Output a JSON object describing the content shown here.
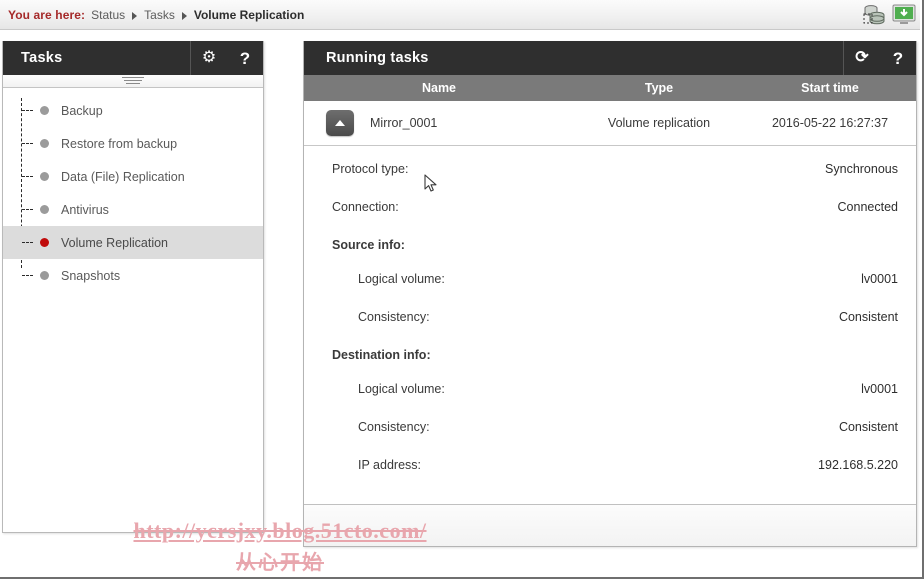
{
  "breadcrumb": {
    "lead": "You are here:",
    "items": [
      "Status",
      "Tasks",
      "Volume Replication"
    ]
  },
  "top_icons": [
    {
      "name": "storage-database-icon"
    },
    {
      "name": "monitor-screen-icon"
    }
  ],
  "sidebar": {
    "title": "Tasks",
    "header_buttons": [
      {
        "name": "gear-icon",
        "glyph": "⚙"
      },
      {
        "name": "help-icon",
        "glyph": "?"
      }
    ],
    "items": [
      {
        "label": "Backup",
        "selected": false
      },
      {
        "label": "Restore from backup",
        "selected": false
      },
      {
        "label": "Data (File) Replication",
        "selected": false
      },
      {
        "label": "Antivirus",
        "selected": false
      },
      {
        "label": "Volume Replication",
        "selected": true
      },
      {
        "label": "Snapshots",
        "selected": false
      }
    ]
  },
  "main": {
    "title": "Running tasks",
    "header_buttons": [
      {
        "name": "refresh-icon",
        "glyph": "⟳"
      },
      {
        "name": "help-icon",
        "glyph": "?"
      }
    ],
    "columns": {
      "name": "Name",
      "type": "Type",
      "start_time": "Start time"
    },
    "task": {
      "name": "Mirror_0001",
      "type": "Volume replication",
      "start_time": "2016-05-22 16:27:37",
      "expanded": true
    },
    "details": [
      {
        "label": "Protocol type:",
        "value": "Synchronous",
        "kind": "row"
      },
      {
        "label": "Connection:",
        "value": "Connected",
        "kind": "row"
      },
      {
        "label": "Source info:",
        "value": "",
        "kind": "section"
      },
      {
        "label": "Logical volume:",
        "value": "lv0001",
        "kind": "indent"
      },
      {
        "label": "Consistency:",
        "value": "Consistent",
        "kind": "indent"
      },
      {
        "label": "Destination info:",
        "value": "",
        "kind": "section"
      },
      {
        "label": "Logical volume:",
        "value": "lv0001",
        "kind": "indent"
      },
      {
        "label": "Consistency:",
        "value": "Consistent",
        "kind": "indent"
      },
      {
        "label": "IP address:",
        "value": "192.168.5.220",
        "kind": "indent"
      }
    ]
  },
  "watermark": {
    "url": "http://ycrsjxy.blog.51cto.com/",
    "tagline": "从心开始"
  },
  "colors": {
    "header_dark": "#2f2f2f",
    "column_header_gray": "#7a7a7a",
    "breadcrumb_accent": "#a52a2a",
    "selected_bullet": "#c00b0b",
    "selected_row": "#dcdcdc",
    "watermark_pink": "#e8a6ad"
  }
}
